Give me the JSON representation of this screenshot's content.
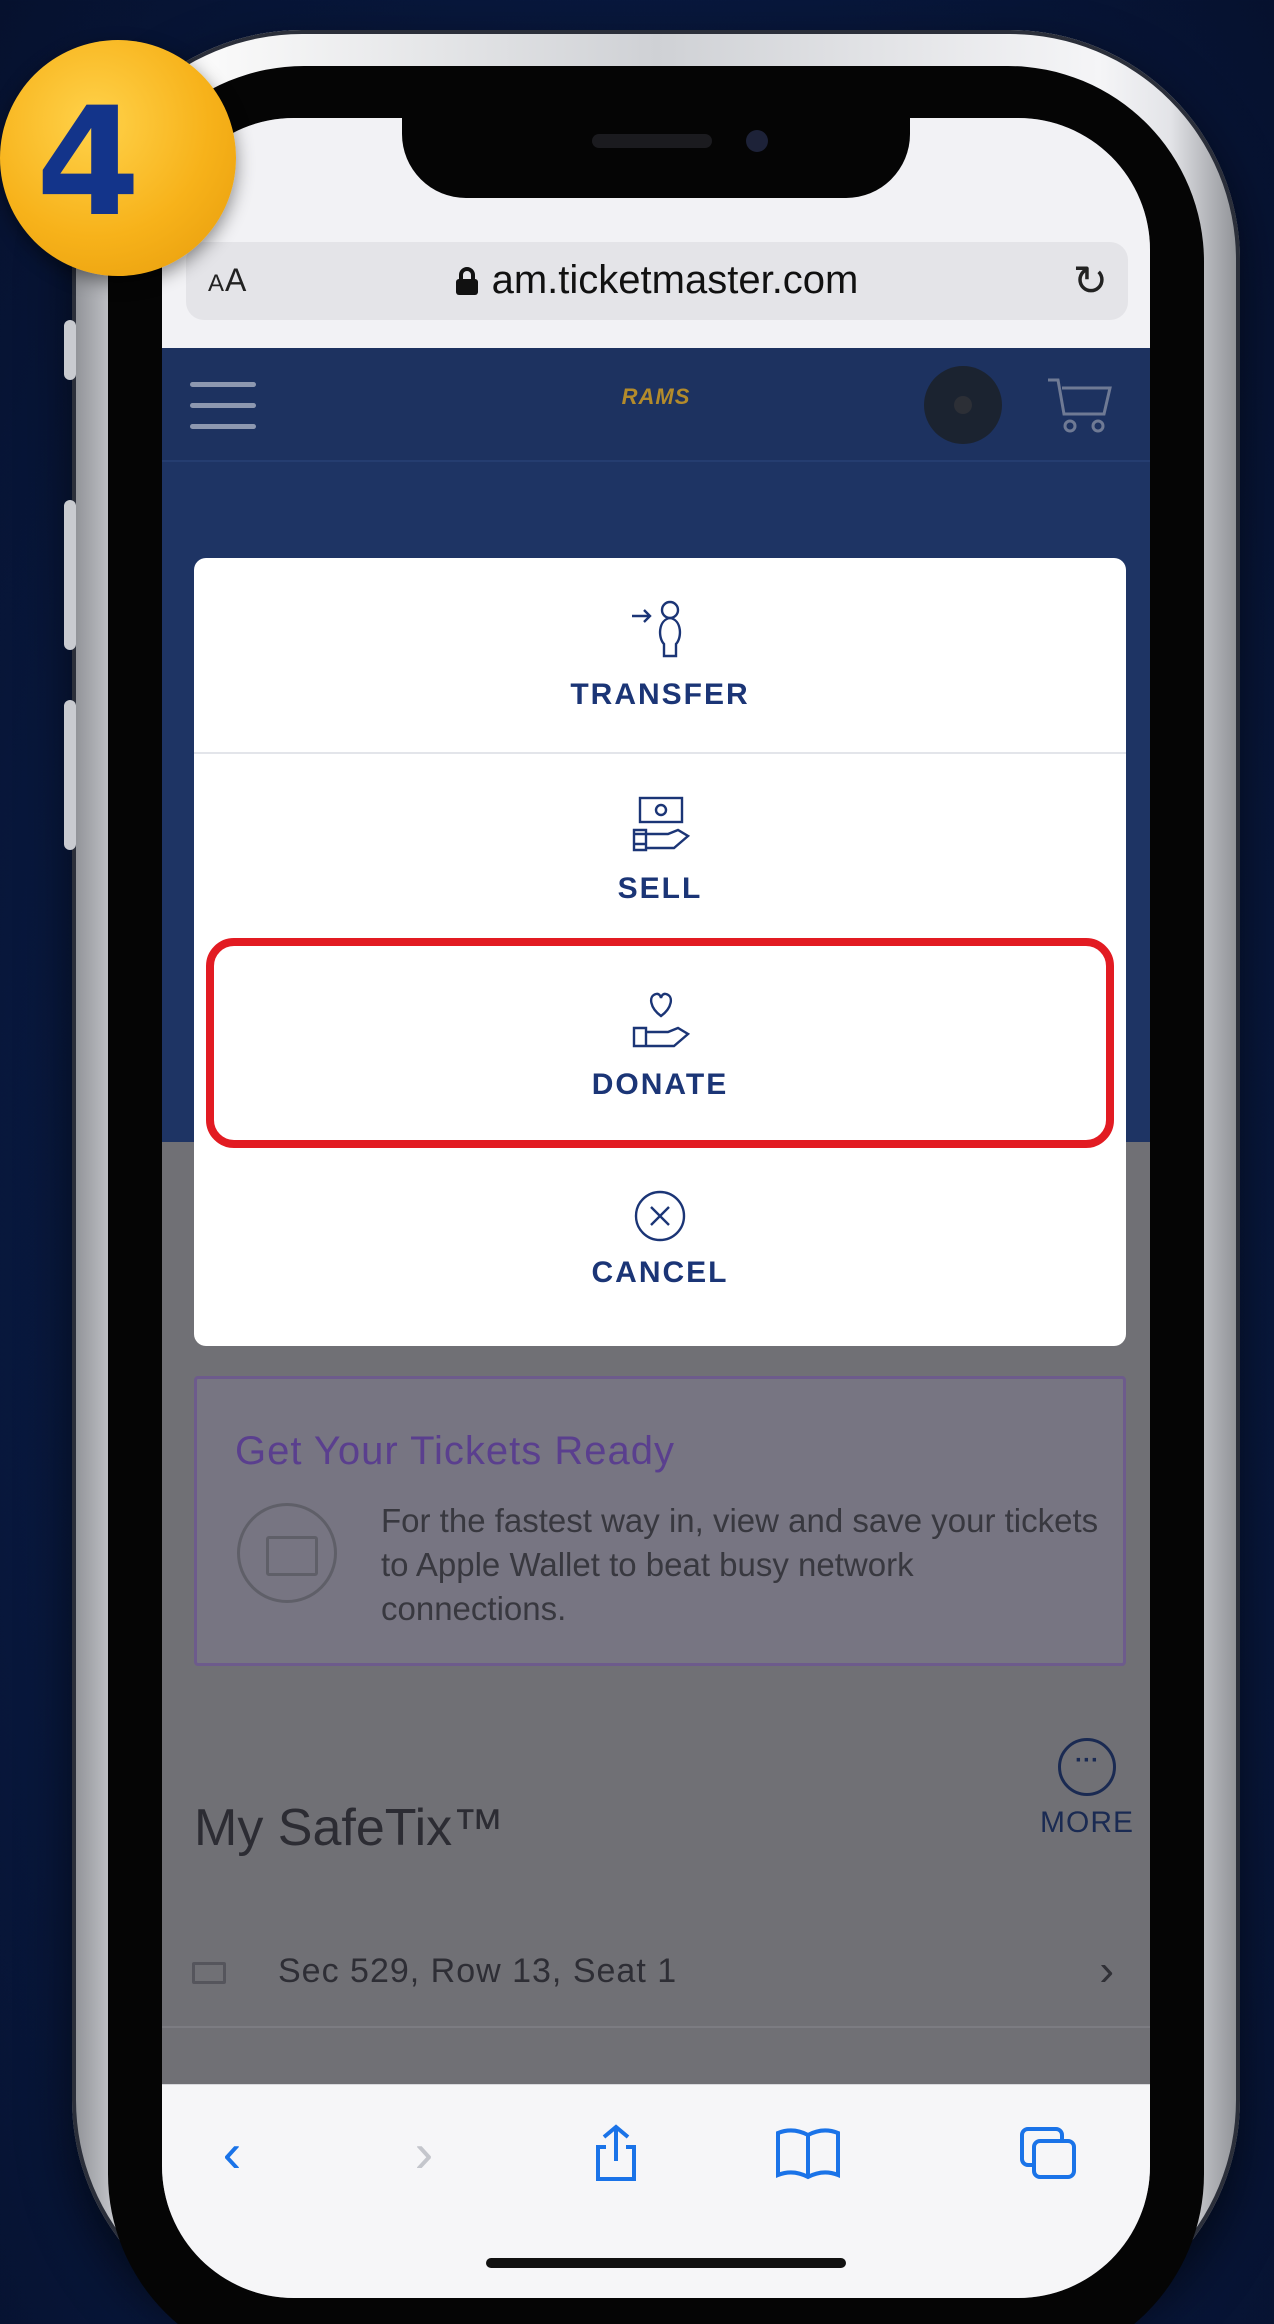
{
  "step_badge": "4",
  "browser": {
    "text_size_label_small": "A",
    "text_size_label_large": "A",
    "url": "am.ticketmaster.com",
    "reload_symbol": "↻"
  },
  "site": {
    "logo_text": "RAMS"
  },
  "modal": {
    "options": [
      {
        "label": "TRANSFER",
        "icon": "transfer-person-icon"
      },
      {
        "label": "SELL",
        "icon": "sell-money-hand-icon"
      },
      {
        "label": "DONATE",
        "icon": "donate-heart-hand-icon",
        "highlighted": true
      },
      {
        "label": "CANCEL",
        "icon": "cancel-circle-x-icon"
      }
    ],
    "highlight_color": "#e21b22",
    "text_color": "#1b3576"
  },
  "tickets_ready": {
    "title": "Get Your Tickets Ready",
    "body": "For the fastest way in, view and save your tickets to Apple Wallet to beat busy network connections."
  },
  "safetix": {
    "title": "My SafeTix™",
    "more_symbol": "···",
    "more_label": "MORE",
    "seat": "Sec 529, Row 13, Seat 1",
    "seat_chevron": "›"
  },
  "toolbar": {
    "back": "‹",
    "forward": "›"
  },
  "colors": {
    "background": "#0a1d48",
    "badge": "#f7b21a",
    "badge_text": "#13348a",
    "safari_blue": "#1a73e8"
  }
}
